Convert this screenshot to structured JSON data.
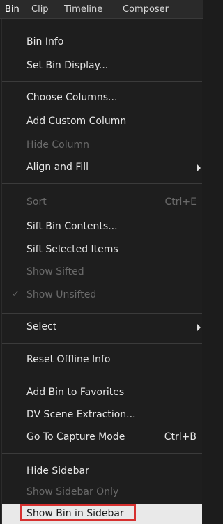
{
  "menubar": {
    "items": [
      {
        "label": "Bin"
      },
      {
        "label": "Clip"
      },
      {
        "label": "Timeline"
      },
      {
        "label": "Composer"
      }
    ]
  },
  "menu": {
    "items": [
      {
        "label": "Bin Info"
      },
      {
        "label": "Set Bin Display..."
      },
      {
        "label": "Choose Columns..."
      },
      {
        "label": "Add Custom Column"
      },
      {
        "label": "Hide Column"
      },
      {
        "label": "Align and Fill"
      },
      {
        "label": "Sort",
        "shortcut": "Ctrl+E"
      },
      {
        "label": "Sift Bin Contents..."
      },
      {
        "label": "Sift Selected Items"
      },
      {
        "label": "Show Sifted"
      },
      {
        "label": "Show Unsifted",
        "check": "✓"
      },
      {
        "label": "Select"
      },
      {
        "label": "Reset Offline Info"
      },
      {
        "label": "Add Bin to Favorites"
      },
      {
        "label": "DV Scene Extraction..."
      },
      {
        "label": "Go To Capture Mode",
        "shortcut": "Ctrl+B"
      },
      {
        "label": "Hide Sidebar"
      },
      {
        "label": "Show Sidebar Only"
      },
      {
        "label": "Show Bin in Sidebar"
      }
    ]
  },
  "colors": {
    "highlight_border": "#d6302f",
    "highlight_background": "#e9e9e9"
  }
}
